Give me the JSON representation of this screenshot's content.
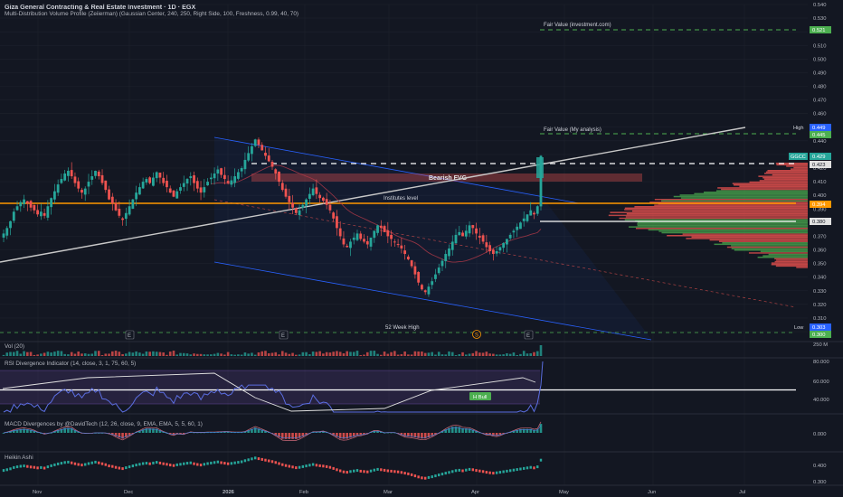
{
  "header": {
    "title": "Giza General Contracting & Real Estate Investment · 1D · EGX",
    "indicator": "Multi-Distribution Volume Profile (Zeiierman) (Gaussian Center, 240, 250, Right Side, 100, Freshness, 0.99, 40, 70)"
  },
  "panes": {
    "vol": "Vol (20)",
    "rsi": "RSI Divergence Indicator (14, close, 3, 1, 75, 60, 5)",
    "macd": "MACD Divergences by @DavidTech (12, 26, close, 9, EMA, EMA, 5, 5, 60, 1)",
    "heikin": "Heikin Ashi"
  },
  "annotations": {
    "fair_value_investing": "Fair Value (investment.com)",
    "fair_value_mine": "Fair Value (My analysis)",
    "bearish_fvg": "Bearish FVG",
    "institutes": "Institutes level",
    "week52": "52 Week High",
    "h_bull": "H Bull",
    "earnings": "E",
    "split": "S"
  },
  "price_tags": {
    "high_label": "High",
    "high": "0.449",
    "fv_mine": "0.445",
    "ticker": "GGCC",
    "last": "0.429",
    "p423": "0.423",
    "orange": "0.394",
    "white": "0.380",
    "fv_invest": "0.521",
    "low_label": "Low",
    "low": "0.303",
    "p300": "0.300"
  },
  "colors": {
    "background": "#131722",
    "up": "#26a69a",
    "down": "#ef5350",
    "orange_line": "#ff9800",
    "fair_value": "#4caf50",
    "channel": "#2962ff",
    "rsi_line": "#5b6ee1",
    "rsi_band": "#7e57c2"
  },
  "chart_data": {
    "type": "candlestick",
    "price_axis_ticks": [
      "0.540",
      "0.530",
      "0.520",
      "0.510",
      "0.500",
      "0.490",
      "0.480",
      "0.470",
      "0.460",
      "0.450",
      "0.440",
      "0.430",
      "0.420",
      "0.410",
      "0.400",
      "0.390",
      "0.380",
      "0.370",
      "0.360",
      "0.350",
      "0.340",
      "0.330",
      "0.320",
      "0.310",
      "0.300"
    ],
    "price_range": [
      0.295,
      0.545
    ],
    "vol_axis_label": "250 M",
    "rsi_axis_ticks": [
      "80.000",
      "60.000",
      "40.000"
    ],
    "macd_axis_ticks": [
      "0.000"
    ],
    "heikin_axis_ticks": [
      "0.400",
      "0.300"
    ],
    "time_axis_labels": [
      "Nov",
      "Dec",
      "2026",
      "Feb",
      "Mar",
      "Apr",
      "May",
      "Jun",
      "Jul"
    ],
    "key_levels": {
      "fair_value_investing": 0.521,
      "fair_value_mine": 0.445,
      "institutes_level": 0.394,
      "support": 0.38,
      "resistance": 0.423,
      "low_52w": 0.3
    },
    "bearish_fvg": [
      0.407,
      0.413
    ],
    "closes": [
      0.372,
      0.376,
      0.381,
      0.388,
      0.392,
      0.395,
      0.397,
      0.394,
      0.391,
      0.389,
      0.386,
      0.388,
      0.385,
      0.392,
      0.398,
      0.403,
      0.408,
      0.412,
      0.416,
      0.418,
      0.414,
      0.409,
      0.405,
      0.402,
      0.405,
      0.41,
      0.414,
      0.418,
      0.414,
      0.409,
      0.404,
      0.397,
      0.394,
      0.389,
      0.385,
      0.382,
      0.387,
      0.392,
      0.397,
      0.402,
      0.406,
      0.41,
      0.412,
      0.409,
      0.413,
      0.417,
      0.413,
      0.409,
      0.406,
      0.402,
      0.399,
      0.403,
      0.406,
      0.409,
      0.412,
      0.414,
      0.409,
      0.405,
      0.402,
      0.406,
      0.41,
      0.413,
      0.416,
      0.419,
      0.415,
      0.412,
      0.409,
      0.411,
      0.414,
      0.417,
      0.42,
      0.426,
      0.431,
      0.436,
      0.441,
      0.437,
      0.433,
      0.429,
      0.425,
      0.421,
      0.416,
      0.41,
      0.404,
      0.399,
      0.395,
      0.391,
      0.387,
      0.389,
      0.393,
      0.397,
      0.401,
      0.405,
      0.401,
      0.398,
      0.396,
      0.393,
      0.389,
      0.383,
      0.376,
      0.37,
      0.364,
      0.362,
      0.366,
      0.369,
      0.372,
      0.368,
      0.366,
      0.364,
      0.369,
      0.374,
      0.378,
      0.376,
      0.373,
      0.37,
      0.368,
      0.366,
      0.364,
      0.361,
      0.357,
      0.353,
      0.348,
      0.342,
      0.336,
      0.331,
      0.329,
      0.333,
      0.337,
      0.342,
      0.347,
      0.352,
      0.357,
      0.361,
      0.366,
      0.371,
      0.373,
      0.37,
      0.374,
      0.378,
      0.376,
      0.372,
      0.369,
      0.366,
      0.362,
      0.359,
      0.357,
      0.359,
      0.362,
      0.365,
      0.368,
      0.371,
      0.374,
      0.377,
      0.38,
      0.383,
      0.386,
      0.389,
      0.386,
      0.392,
      0.429
    ]
  }
}
